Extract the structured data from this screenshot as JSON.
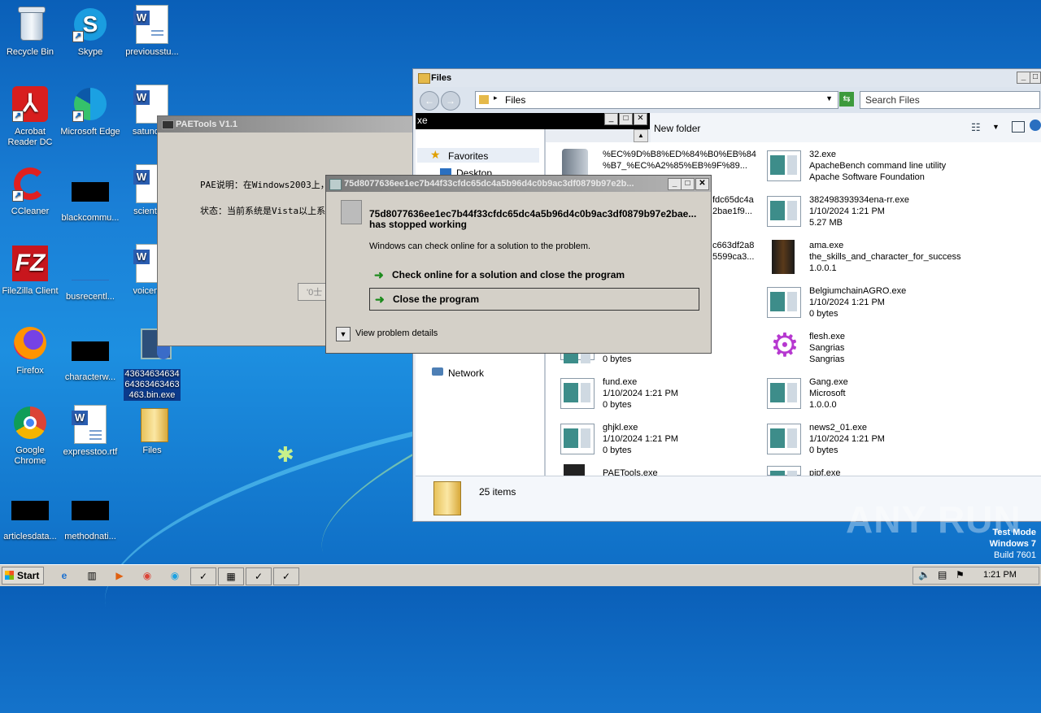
{
  "desktop": {
    "icons": [
      {
        "label": "Recycle Bin"
      },
      {
        "label": "Skype"
      },
      {
        "label": "previousstu..."
      },
      {
        "label": "Acrobat Reader DC"
      },
      {
        "label": "Microsoft Edge"
      },
      {
        "label": "satunde..."
      },
      {
        "label": "CCleaner"
      },
      {
        "label": "blackcommu..."
      },
      {
        "label": "scientifi..."
      },
      {
        "label": "FileZilla Client"
      },
      {
        "label": "busrecentl..."
      },
      {
        "label": "voicene..."
      },
      {
        "label": "Firefox"
      },
      {
        "label": "characterw..."
      },
      {
        "label": "43634634634 64363463463 463.bin.exe"
      },
      {
        "label": "Google Chrome"
      },
      {
        "label": "expresstoo.rtf"
      },
      {
        "label": "Files"
      },
      {
        "label": "articlesdata..."
      },
      {
        "label": "methodnati..."
      }
    ]
  },
  "paetools": {
    "title": "PAETools V1.1",
    "line1": "PAE说明：在Windows2003上，",
    "line2": "状态：当前系统是Vista以上系",
    "button": "'0士"
  },
  "explorer": {
    "title": "Files",
    "address": "Files",
    "search_placeholder": "Search Files",
    "new_folder": "New folder",
    "nav_pane_title": "xe",
    "nav": {
      "favorites": "Favorites",
      "desktop": "Desktop",
      "network": "Network"
    },
    "files": [
      {
        "name": "%EC%9D%B8%ED%84%B0%EB%84",
        "l2": "%B7_%EC%A2%85%EB%9F%89...",
        "l3": ""
      },
      {
        "name": "32.exe",
        "l2": "ApacheBench command line utility",
        "l3": "Apache Software Foundation"
      },
      {
        "name": "fdc65dc4a",
        "l2": "2bae1f9...",
        "l3": ""
      },
      {
        "name": "382498393934ena-rr.exe",
        "l2": "1/10/2024 1:21 PM",
        "l3": "5.27 MB"
      },
      {
        "name": "c663df2a8",
        "l2": "5599ca3...",
        "l3": ""
      },
      {
        "name": "ama.exe",
        "l2": "the_skills_and_character_for_success",
        "l3": "1.0.0.1"
      },
      {
        "name": "BelgiumchainAGRO.exe",
        "l2": "1/10/2024 1:21 PM",
        "l3": "0 bytes"
      },
      {
        "name": "",
        "l2": "",
        "l3": "0 bytes"
      },
      {
        "name": "flesh.exe",
        "l2": "Sangrias",
        "l3": "Sangrias"
      },
      {
        "name": "fund.exe",
        "l2": "1/10/2024 1:21 PM",
        "l3": "0 bytes"
      },
      {
        "name": "Gang.exe",
        "l2": "Microsoft",
        "l3": "1.0.0.0"
      },
      {
        "name": "ghjkl.exe",
        "l2": "1/10/2024 1:21 PM",
        "l3": "0 bytes"
      },
      {
        "name": "news2_01.exe",
        "l2": "1/10/2024 1:21 PM",
        "l3": "0 bytes"
      },
      {
        "name": "PAETools.exe",
        "l2": "",
        "l3": ""
      },
      {
        "name": "pipf.exe",
        "l2": "",
        "l3": ""
      }
    ],
    "status": "25 items"
  },
  "crash_dialog": {
    "title": "75d8077636ee1ec7b44f33cfdc65dc4a5b96d4c0b9ac3df0879b97e2b...",
    "app_name": "75d8077636ee1ec7b44f33cfdc65dc4a5b96d4c0b9ac3df0879b97e2bae...",
    "stopped": "has stopped working",
    "message": "Windows can check online for a solution to the problem.",
    "option1": "Check online for a solution and close the program",
    "option2": "Close the program",
    "details": "View problem details"
  },
  "watermark": {
    "mode": "Test Mode",
    "os": "Windows 7",
    "build": "Build 7601",
    "brand": "ANY RUN"
  },
  "taskbar": {
    "start": "Start",
    "clock": "1:21 PM"
  }
}
